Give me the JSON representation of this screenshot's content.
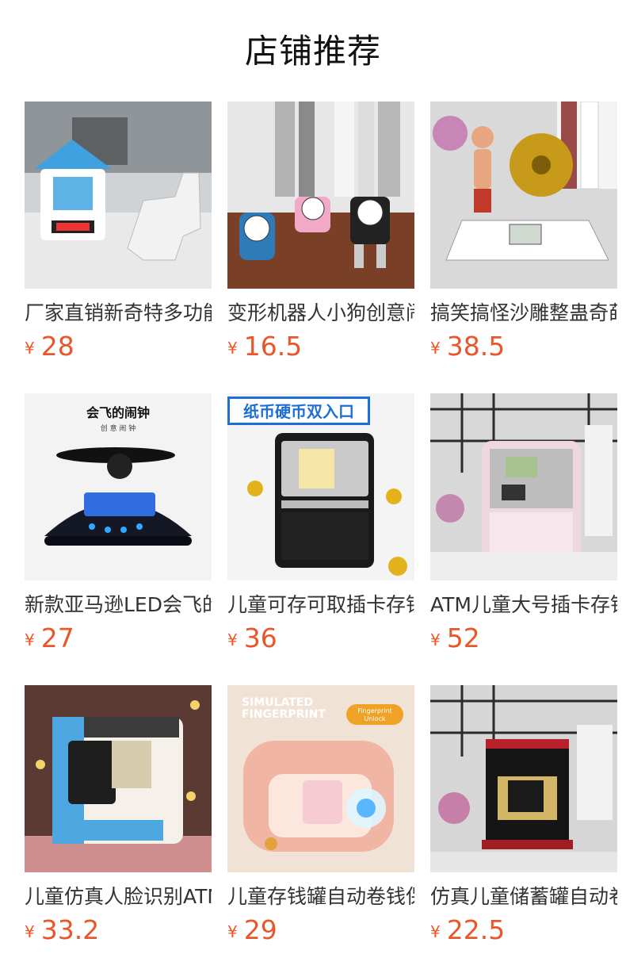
{
  "section": {
    "title": "店铺推荐"
  },
  "currency_symbol": "¥",
  "products": [
    {
      "name": "厂家直销新奇特多功能闹钟",
      "price": "28",
      "image": "house-clock-gun"
    },
    {
      "name": "变形机器人小狗创意闹钟",
      "price": "16.5",
      "image": "robot-dog-clocks"
    },
    {
      "name": "搞笑搞怪沙雕整蛊奇葩闹钟",
      "price": "38.5",
      "image": "gong-man-clock"
    },
    {
      "name": "新款亚马逊LED会飞的闹钟",
      "price": "27",
      "image": "flying-led-clock",
      "image_text": [
        "会飞的闹钟",
        "创 意 闹 钟"
      ]
    },
    {
      "name": "儿童可存可取插卡存钱罐",
      "price": "36",
      "image": "atm-bank-black",
      "image_text": [
        "纸币硬币双入口"
      ]
    },
    {
      "name": "ATM儿童大号插卡存钱罐",
      "price": "52",
      "image": "atm-bank-pink"
    },
    {
      "name": "儿童仿真人脸识别ATM存钱罐",
      "price": "33.2",
      "image": "face-id-atm"
    },
    {
      "name": "儿童存钱罐自动卷钱保险箱",
      "price": "29",
      "image": "fingerprint-safe",
      "image_text": [
        "SIMULATED",
        "FINGERPRINT",
        "Fingerprint",
        "Unlock"
      ]
    },
    {
      "name": "仿真儿童储蓄罐自动卷钱机",
      "price": "22.5",
      "image": "mini-safe-bank"
    }
  ]
}
